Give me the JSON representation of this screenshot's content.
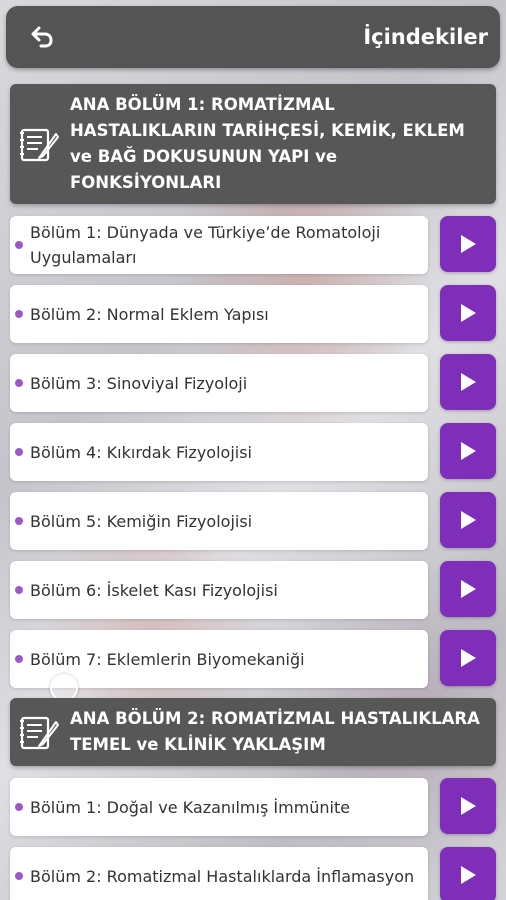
{
  "header": {
    "title": "İçindekiler",
    "back_icon": "back-arrow-icon"
  },
  "sections": [
    {
      "icon": "book-edit-icon",
      "title": "ANA BÖLÜM 1: ROMATİZMAL HASTALIKLARIN TARİHÇESİ, KEMİK, EKLEM ve BAĞ DOKUSUNUN YAPI ve FONKSİYONLARI",
      "items": [
        {
          "label": "Bölüm 1: Dünyada ve Türkiye’de Romatoloji Uygulamaları"
        },
        {
          "label": "Bölüm 2: Normal Eklem Yapısı"
        },
        {
          "label": "Bölüm 3: Sinoviyal Fizyoloji"
        },
        {
          "label": "Bölüm 4: Kıkırdak Fizyolojisi"
        },
        {
          "label": "Bölüm 5: Kemiğin Fizyolojisi"
        },
        {
          "label": "Bölüm 6: İskelet Kası Fizyolojisi"
        },
        {
          "label": "Bölüm 7: Eklemlerin Biyomekaniği"
        }
      ]
    },
    {
      "icon": "book-edit-icon",
      "title": "ANA BÖLÜM 2: ROMATİZMAL HASTALIKLARA TEMEL ve KLİNİK YAKLAŞIM",
      "items": [
        {
          "label": "Bölüm 1: Doğal ve Kazanılmış İmmünite"
        },
        {
          "label": "Bölüm 2: Romatizmal Hastalıklarda İnflamasyon"
        }
      ]
    }
  ],
  "play_icon": "play-icon",
  "colors": {
    "header_bg": "#545454",
    "section_bg": "#575757",
    "accent_purple": "#7e2eb8",
    "bullet_purple": "#9b59c9"
  }
}
